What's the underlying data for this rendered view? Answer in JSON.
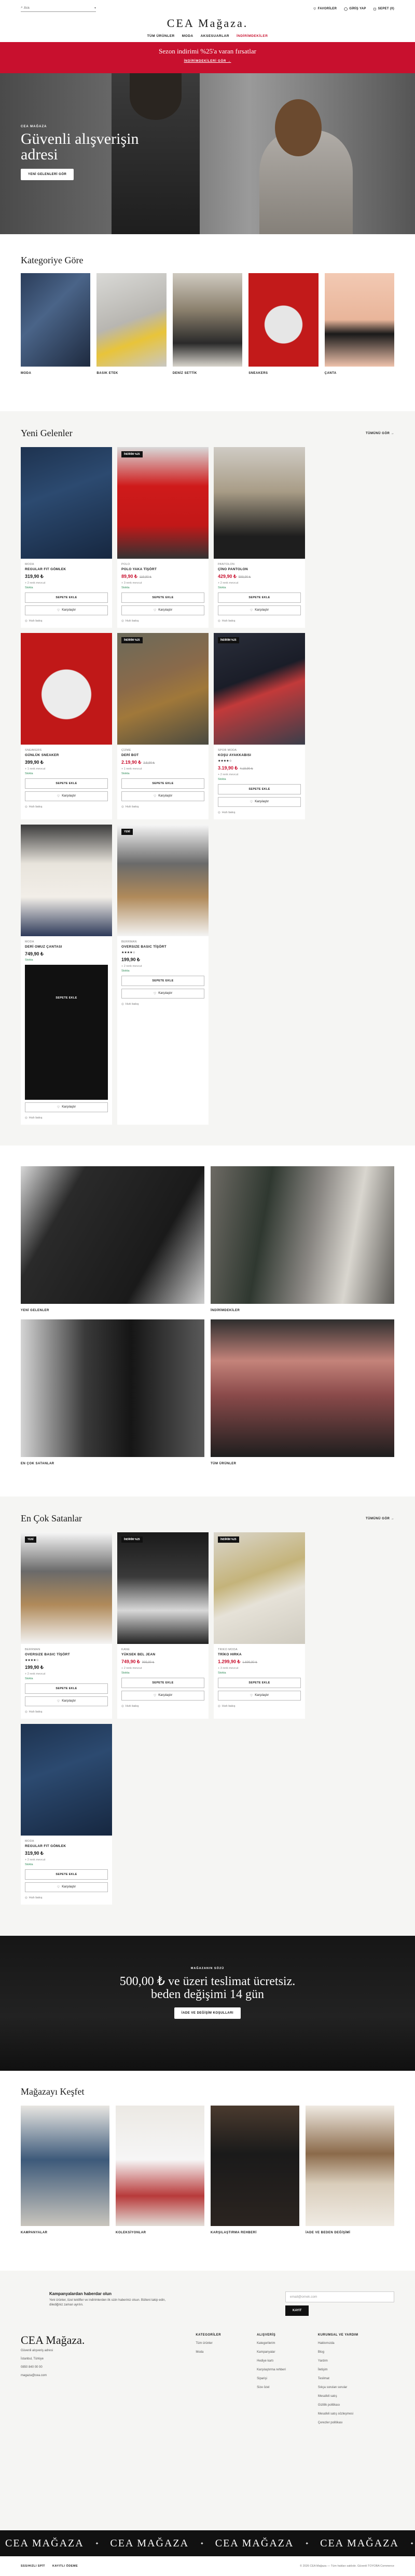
{
  "header": {
    "search_placeholder": "Ara",
    "logo": "CEA Mağaza.",
    "actions": {
      "favorites": "FAVORİLER",
      "login": "GİRİŞ YAP",
      "cart": "SEPET (0)"
    },
    "nav": [
      "TÜM ÜRÜNLER",
      "MODA",
      "AKSESUARLAR",
      "İNDİRİMDEKİLER"
    ]
  },
  "promo": {
    "text": "Sezon indirimi %25'a varan fırsatlar",
    "cta": "İNDİRİMDEKİLERİ GÖR →"
  },
  "hero": {
    "eyebrow": "CEA MAĞAZA",
    "title": "Güvenli alışverişin adresi",
    "cta": "YENİ GELENLERİ GÖR"
  },
  "categories": {
    "title": "Kategoriye Göre",
    "items": [
      {
        "label": "MODA"
      },
      {
        "label": "BASIK ETEK"
      },
      {
        "label": "DENİZ SETTİK"
      },
      {
        "label": "SNEAKERS"
      },
      {
        "label": "ÇANTA"
      }
    ]
  },
  "new_arrivals": {
    "title": "Yeni Gelenler",
    "see_all": "TÜMÜNÜ GÖR",
    "add_label": "SEPETE EKLE",
    "fav_label": "Karşılaştır",
    "hidden_label": "Hızlı bakış",
    "products": [
      {
        "brand": "MODA",
        "name": "REGULAR FIT GÖMLEK",
        "price": "319,90 ₺",
        "old": "",
        "color": "+ 2 renk mevcut",
        "stock": "Stokta",
        "badge": "",
        "stars": ""
      },
      {
        "brand": "POLO",
        "name": "POLO YAKA TİŞÖRT",
        "price": "89,90 ₺",
        "old": "119,90 ₺",
        "color": "+ 3 renk mevcut",
        "stock": "Stokta",
        "badge": "İNDİRİM %25",
        "stars": ""
      },
      {
        "brand": "PANTOLON",
        "name": "ÇİNO PANTOLON",
        "price": "429,90 ₺",
        "old": "599,90 ₺",
        "color": "+ 2 renk mevcut",
        "stock": "Stokta",
        "badge": "",
        "stars": ""
      },
      {
        "brand": "SNEAKERS",
        "name": "GÜNLÜK SNEAKER",
        "price": "399,90 ₺",
        "old": "",
        "color": "+ 1 renk mevcut",
        "stock": "Stokta",
        "badge": "",
        "stars": ""
      },
      {
        "brand": "ÇİZME",
        "name": "DERİ BOT",
        "price": "2.19,90 ₺",
        "old": "2.5,90 ₺",
        "color": "+ 1 renk mevcut",
        "stock": "Stokta",
        "badge": "İNDİRİM %25",
        "stars": ""
      },
      {
        "brand": "SPOR MODA",
        "name": "KOŞU AYAKKABISI",
        "price": "3.19,90 ₺",
        "old": "4.19,90 ₺",
        "color": "+ 2 renk mevcut",
        "stock": "Stokta",
        "badge": "İNDİRİM %25",
        "stars": "★★★★☆"
      },
      {
        "brand": "MODA",
        "name": "DERİ OMUZ ÇANTASI",
        "price": "749,90 ₺",
        "old": "",
        "color": "",
        "stock": "Stokta",
        "badge": "",
        "stars": ""
      },
      {
        "brand": "BERRMAN",
        "name": "OVERSIZE BASIC TİŞÖRT",
        "price": "199,90 ₺",
        "old": "",
        "color": "+ 2 renk mevcut",
        "stock": "Stokta",
        "badge": "YENİ",
        "stars": "★★★★☆"
      }
    ]
  },
  "editorial": {
    "items": [
      {
        "label": "YENİ GELENLER"
      },
      {
        "label": "İNDİRİMDEKİLER"
      },
      {
        "label": "EN ÇOK SATANLAR"
      },
      {
        "label": "TÜM ÜRÜNLER"
      }
    ]
  },
  "best_sellers": {
    "title": "En Çok Satanlar",
    "see_all": "TÜMÜNÜ GÖR",
    "products": [
      {
        "brand": "BERRMAN",
        "name": "OVERSIZE BASIC TİŞÖRT",
        "price": "199,90 ₺",
        "old": "",
        "color": "+ 2 renk mevcut",
        "stock": "Stokta",
        "badge": "YENİ",
        "stars": "★★★★☆"
      },
      {
        "brand": "KANE",
        "name": "YÜKSEK BEL JEAN",
        "price": "749,90 ₺",
        "old": "999,90 ₺",
        "color": "+ 2 renk mevcut",
        "stock": "Stokta",
        "badge": "İNDİRİM %25",
        "stars": ""
      },
      {
        "brand": "TRIKO MODA",
        "name": "TRİKO HIRKA",
        "price": "1.299,90 ₺",
        "old": "1.699,90 ₺",
        "color": "+ 3 renk mevcut",
        "stock": "Stokta",
        "badge": "İNDİRİM %25",
        "stars": ""
      },
      {
        "brand": "MODA",
        "name": "REGULAR FIT GÖMLEK",
        "price": "319,90 ₺",
        "old": "",
        "color": "+ 2 renk mevcut",
        "stock": "Stokta",
        "badge": "",
        "stars": ""
      }
    ]
  },
  "shipping": {
    "eyebrow": "MAĞAZANIN SÖZÜ",
    "title": "500,00 ₺ ve üzeri teslimat ücretsiz. beden değişimi 14 gün",
    "cta": "İADE VE DEĞİŞİM KOŞULLARI"
  },
  "discover": {
    "title": "Mağazayı Keşfet",
    "items": [
      {
        "label": "KAMPANYALAR"
      },
      {
        "label": "KOLEKSİYONLAR"
      },
      {
        "label": "KARŞILAŞTIRMA REHBERİ"
      },
      {
        "label": "İADE VE BEDEN DEĞİŞİMİ"
      }
    ]
  },
  "footer": {
    "news_title": "Kampanyalardan haberdar olun",
    "news_sub": "Yeni ürünler, özel teklifler ve indirimlerden ilk sizin haberiniz olsun. Bülteni takip edin, dilediğiniz zaman ayrılın.",
    "email_placeholder": "email@ornek.com",
    "subscribe": "KAYIT",
    "brand": "CEA Mağaza.",
    "tagline": "Güvenli alışveriş adresi",
    "address": "İstanbul, Türkiye",
    "phone": "0850 840 00 00",
    "email": "magaza@cea.com",
    "cols": [
      {
        "title": "KATEGORİLER",
        "links": [
          "Tüm ürünler",
          "Moda"
        ]
      },
      {
        "title": "ALIŞVERİŞ",
        "links": [
          "Kategorilerim",
          "Kampanyalar",
          "Hediye kartı",
          "Karşılaştırma rehberi",
          "Siparişi",
          "Size özel"
        ]
      },
      {
        "title": "KURUMSAL VE YARDIM",
        "links": [
          "Hakkımızda",
          "Blog",
          "Yardım",
          "İletişim",
          "Teslimat",
          "Sıkça sorulan sorular",
          "Mesafeli satış",
          "Gizlilik politikası",
          "Mesafeli satış sözleşmesi",
          "Çerezler politikası"
        ]
      }
    ],
    "marquee": "CEA MAĞAZA",
    "bottom_links": [
      "SSS/HIZLI SPİT",
      "KAYITLI ÖDEME"
    ],
    "copyright": "© 2026 CEA Mağaza — Tüm hakları saklıdır. Güvenli TOYOBA Commerce"
  }
}
